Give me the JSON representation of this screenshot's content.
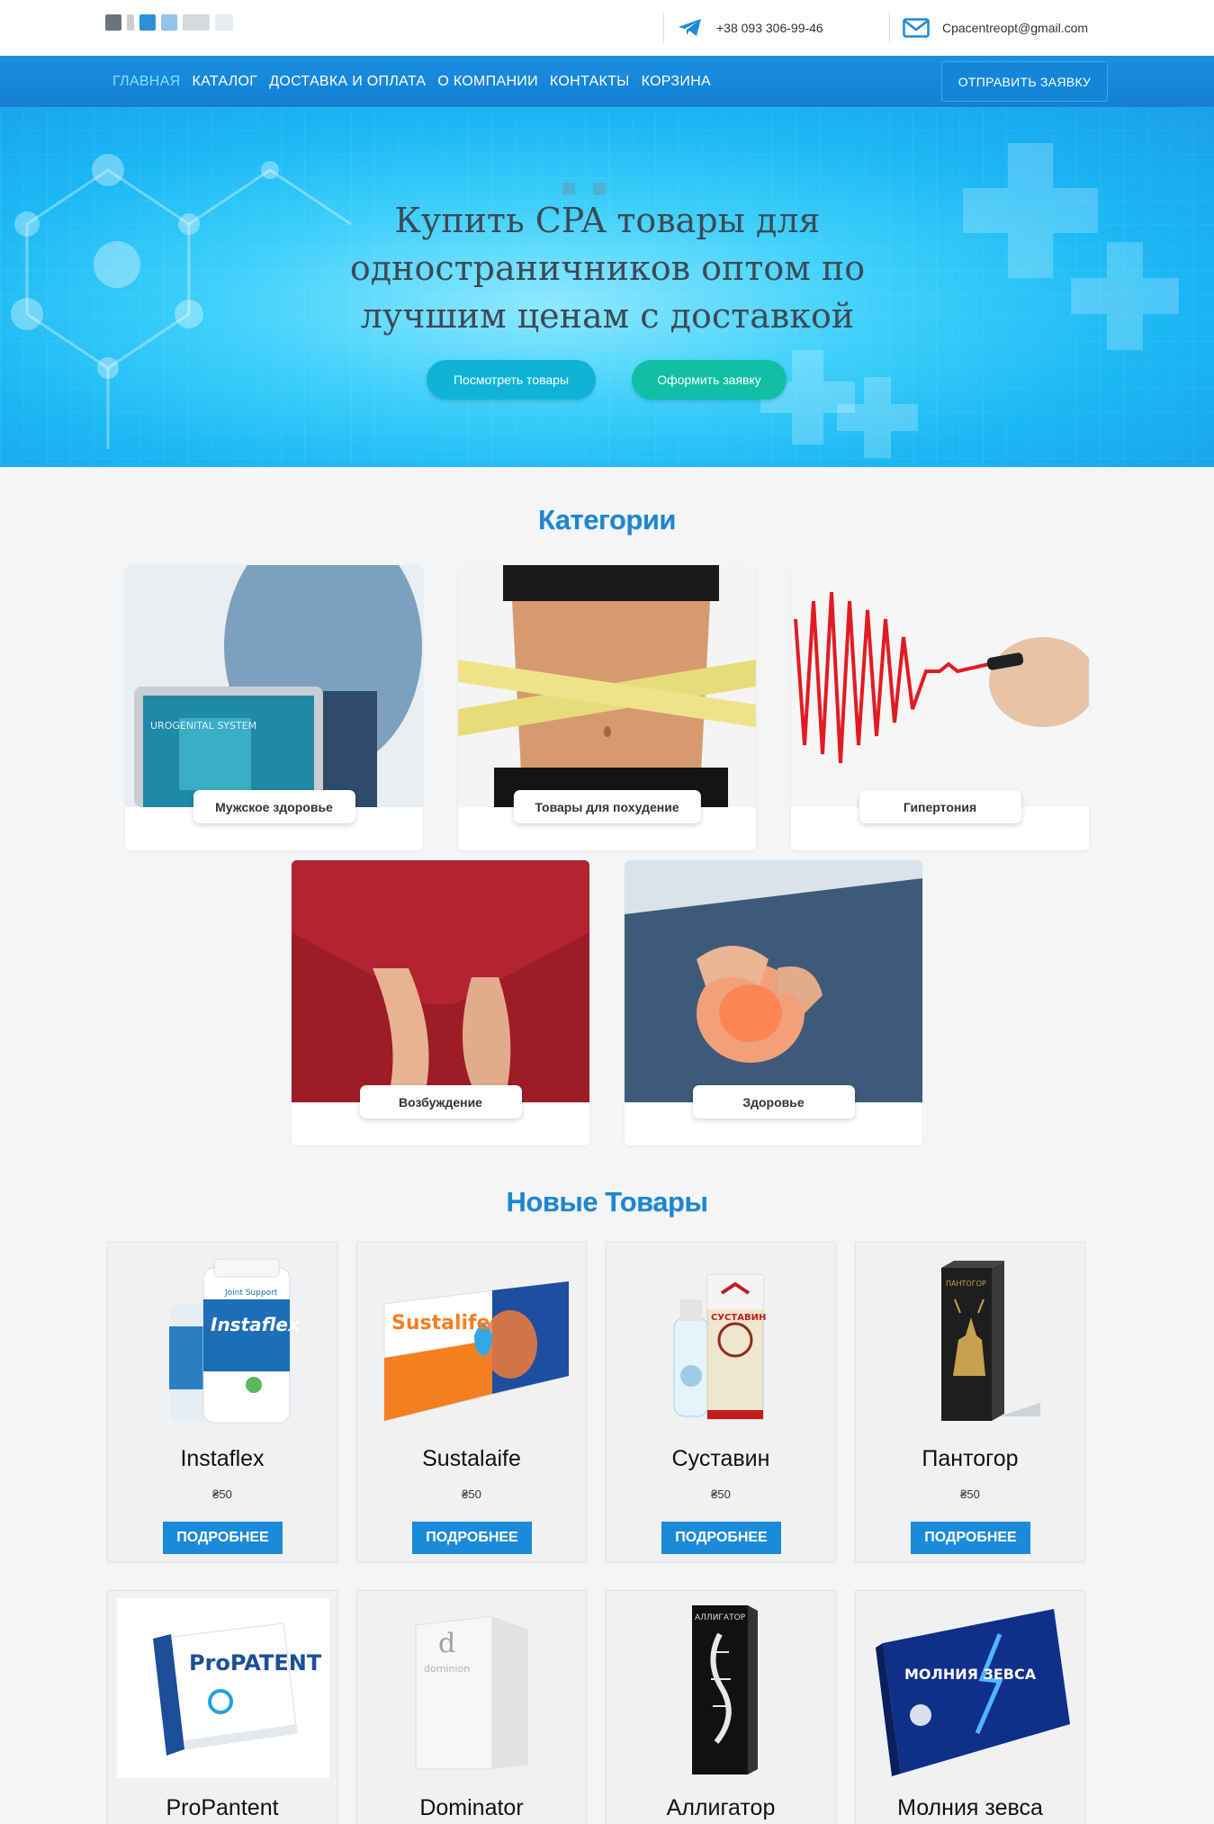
{
  "header": {
    "phone": "+38 093 306-99-46",
    "email": "Cpacentreopt@gmail.com",
    "icons": {
      "phone": "telegram-icon",
      "email": "envelope-icon"
    }
  },
  "nav": {
    "items": [
      {
        "label": "ГЛАВНАЯ",
        "active": true
      },
      {
        "label": "КАТАЛОГ",
        "active": false
      },
      {
        "label": "ДОСТАВКА И ОПЛАТА",
        "active": false
      },
      {
        "label": "О КОМПАНИИ",
        "active": false
      },
      {
        "label": "КОНТАКТЫ",
        "active": false
      },
      {
        "label": "КОРЗИНА",
        "active": false
      }
    ],
    "cta_label": "ОТПРАВИТЬ ЗАЯВКУ"
  },
  "hero": {
    "title": "Купить CPA товары для одностраничников оптом по лучшим ценам с доставкой",
    "button_view": "Посмотреть товары",
    "button_order": "Оформить заявку"
  },
  "categories": {
    "title": "Категории",
    "items": [
      {
        "label": "Мужское здоровье"
      },
      {
        "label": "Товары для похудение"
      },
      {
        "label": "Гипертония"
      },
      {
        "label": "Возбуждение"
      },
      {
        "label": "Здоровье"
      }
    ]
  },
  "products": {
    "title": "Новые Товары",
    "button_label": "ПОДРОБНЕЕ",
    "items": [
      {
        "name": "Instaflex",
        "price": "₴50"
      },
      {
        "name": "Sustalaife",
        "price": "₴50"
      },
      {
        "name": "Суставин",
        "price": "₴50"
      },
      {
        "name": "Пантогор",
        "price": "₴50"
      },
      {
        "name": "ProPantent",
        "price": ""
      },
      {
        "name": "Dominator",
        "price": ""
      },
      {
        "name": "Аллигатор",
        "price": ""
      },
      {
        "name": "Молния зевса",
        "price": ""
      }
    ],
    "packaging_text": {
      "instaflex": "Instaflex",
      "instaflex_tag": "Joint Support",
      "sustalife": "Sustalife",
      "sustavin": "СУСТАВИН",
      "pantogor": "ПАНТОГОР",
      "propatent": "ProPATENT",
      "dominion": "dominion",
      "alligator": "АЛЛИГАТОР",
      "molnia": "МОЛНИЯ ЗЕВСА",
      "urogenital": "UROGENITAL SYSTEM"
    }
  },
  "colors": {
    "brand_blue": "#1b8ad8",
    "nav_active": "#7fe3ff",
    "hero_btn_view": "#0fb3d6",
    "hero_btn_order": "#10bfa4",
    "section_title": "#1d86d1"
  }
}
